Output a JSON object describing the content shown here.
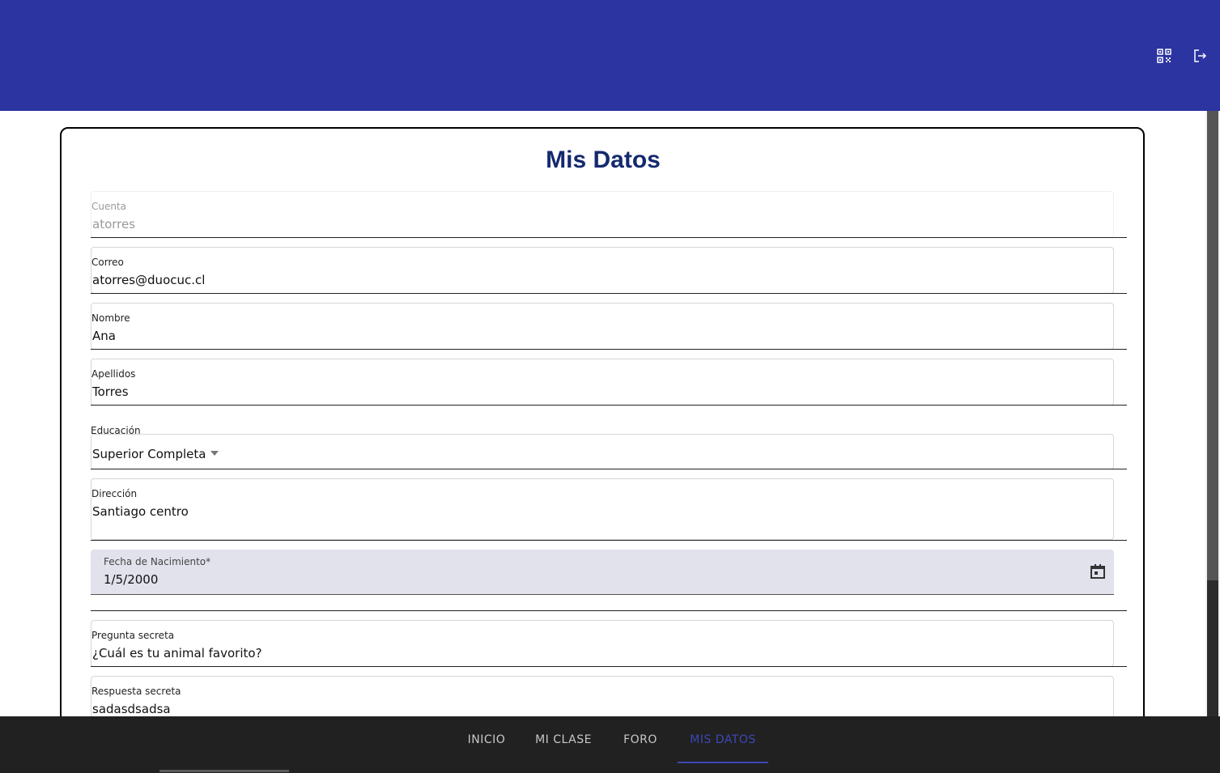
{
  "toolbar": {
    "icons": [
      "qr-code-icon",
      "logout-icon"
    ],
    "color": "#2b34a1"
  },
  "page": {
    "title": "Mis Datos"
  },
  "form": {
    "cuenta": {
      "label": "Cuenta",
      "value": "atorres",
      "disabled": true
    },
    "correo": {
      "label": "Correo",
      "value": "atorres@duocuc.cl"
    },
    "nombre": {
      "label": "Nombre",
      "value": "Ana"
    },
    "apellidos": {
      "label": "Apellidos",
      "value": "Torres"
    },
    "educacion": {
      "label": "Educación",
      "value": "Superior Completa"
    },
    "direccion": {
      "label": "Dirección",
      "value": "Santiago centro"
    },
    "fecha": {
      "label": "Fecha de Nacimiento*",
      "value": "1/5/2000",
      "icon": "calendar-icon"
    },
    "pregunta": {
      "label": "Pregunta secreta",
      "value": "¿Cuál es tu animal favorito?"
    },
    "respuesta": {
      "label": "Respuesta secreta",
      "value": "sadasdsadsa"
    }
  },
  "tabs": [
    {
      "label": "INICIO",
      "active": false
    },
    {
      "label": "MI CLASE",
      "active": false
    },
    {
      "label": "FORO",
      "active": false
    },
    {
      "label": "MIS DATOS",
      "active": true
    }
  ],
  "colors": {
    "title": "#15296e",
    "active_tab": "#3e47b8",
    "bottom_bar": "#212121"
  }
}
